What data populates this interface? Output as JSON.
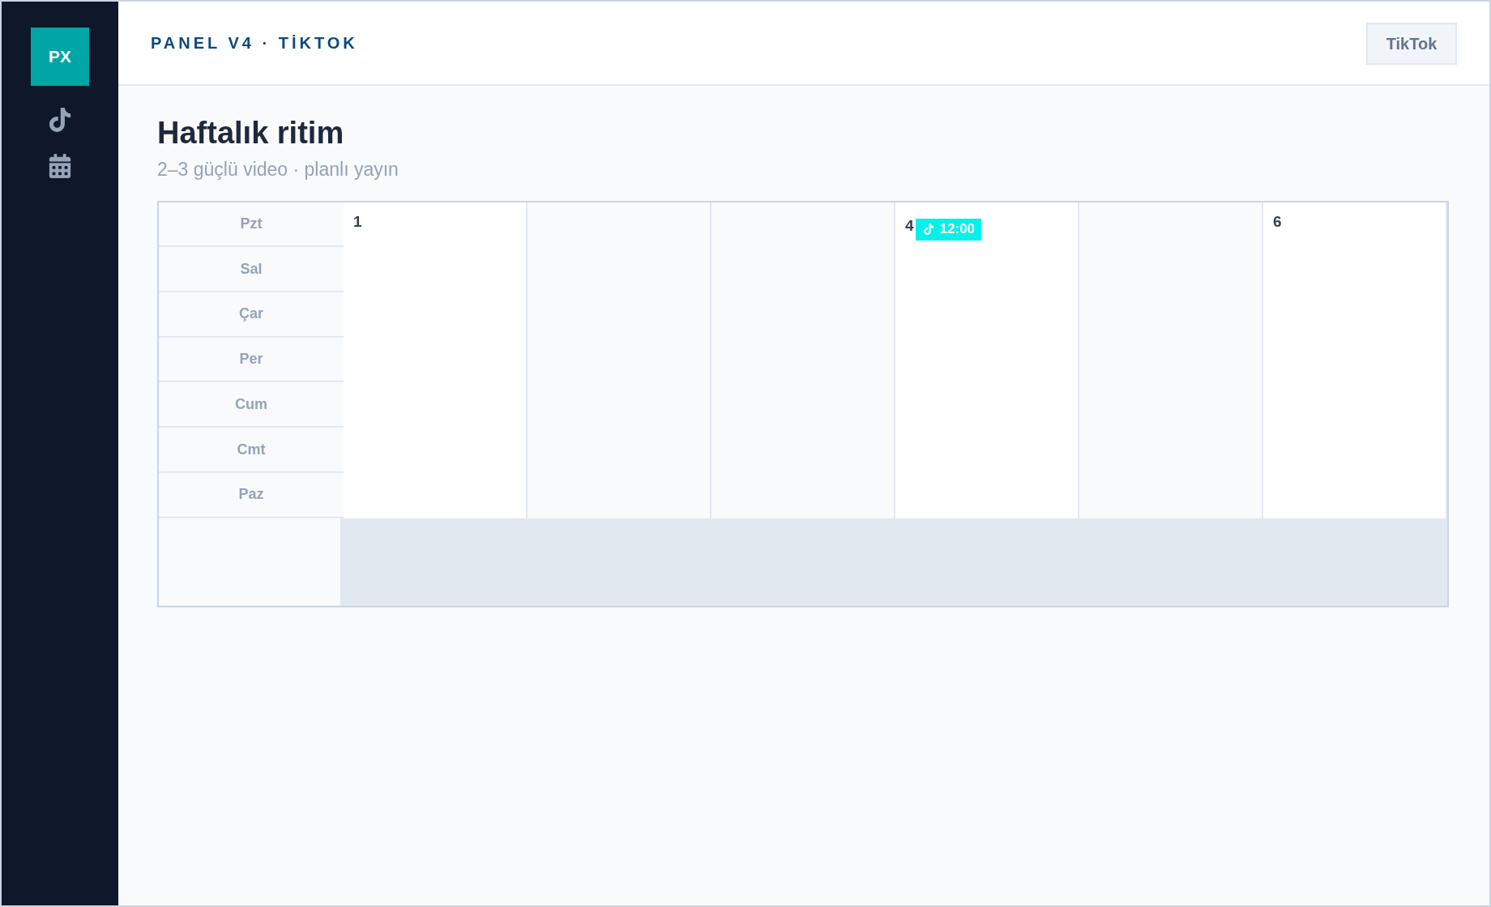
{
  "sidebar": {
    "logo": "PX"
  },
  "header": {
    "title": "PANEL V4 · TİKTOK",
    "button": "TikTok"
  },
  "page": {
    "title": "Haftalık ritim",
    "subtitle": "2–3 güçlü video · planlı yayın"
  },
  "calendar": {
    "weekdays": [
      "Pzt",
      "Sal",
      "Çar",
      "Per",
      "Cum",
      "Cmt",
      "Paz"
    ],
    "cells": [
      {
        "kind": "day",
        "number": "1"
      },
      {
        "kind": "blank"
      },
      {
        "kind": "blank"
      },
      {
        "kind": "day",
        "number": "4",
        "events": [
          {
            "time": "12:00",
            "color": "#00f2ea"
          }
        ]
      },
      {
        "kind": "blank"
      },
      {
        "kind": "day",
        "number": "6"
      }
    ]
  }
}
